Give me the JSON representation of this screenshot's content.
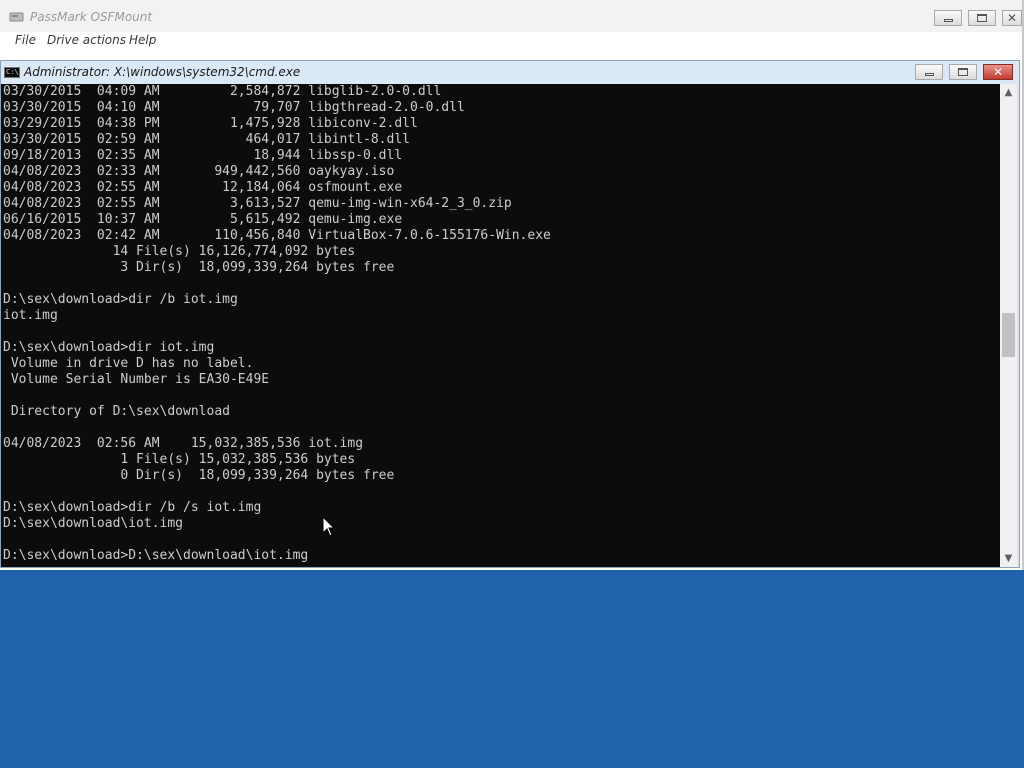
{
  "osfmount": {
    "title": "PassMark OSFMount",
    "menu": [
      "File",
      "Drive actions",
      "Help"
    ]
  },
  "cmd": {
    "title": "Administrator: X:\\windows\\system32\\cmd.exe",
    "lines": [
      "03/30/2015  04:09 AM         2,584,872 libglib-2.0-0.dll",
      "03/30/2015  04:10 AM            79,707 libgthread-2.0-0.dll",
      "03/29/2015  04:38 PM         1,475,928 libiconv-2.dll",
      "03/30/2015  02:59 AM           464,017 libintl-8.dll",
      "09/18/2013  02:35 AM            18,944 libssp-0.dll",
      "04/08/2023  02:33 AM       949,442,560 oaykyay.iso",
      "04/08/2023  02:55 AM        12,184,064 osfmount.exe",
      "04/08/2023  02:55 AM         3,613,527 qemu-img-win-x64-2_3_0.zip",
      "06/16/2015  10:37 AM         5,615,492 qemu-img.exe",
      "04/08/2023  02:42 AM       110,456,840 VirtualBox-7.0.6-155176-Win.exe",
      "              14 File(s) 16,126,774,092 bytes",
      "               3 Dir(s)  18,099,339,264 bytes free",
      "",
      "D:\\sex\\download>dir /b iot.img",
      "iot.img",
      "",
      "D:\\sex\\download>dir iot.img",
      " Volume in drive D has no label.",
      " Volume Serial Number is EA30-E49E",
      "",
      " Directory of D:\\sex\\download",
      "",
      "04/08/2023  02:56 AM    15,032,385,536 iot.img",
      "               1 File(s) 15,032,385,536 bytes",
      "               0 Dir(s)  18,099,339,264 bytes free",
      "",
      "D:\\sex\\download>dir /b /s iot.img",
      "D:\\sex\\download\\iot.img",
      "",
      "D:\\sex\\download>D:\\sex\\download\\iot.img"
    ]
  },
  "colors": {
    "desktop": "#1f63ad",
    "console_bg": "#0c0c0c",
    "console_text": "#cccccc"
  },
  "icons": {
    "scroll_up": "▲",
    "scroll_down": "▼",
    "close": "✕"
  }
}
